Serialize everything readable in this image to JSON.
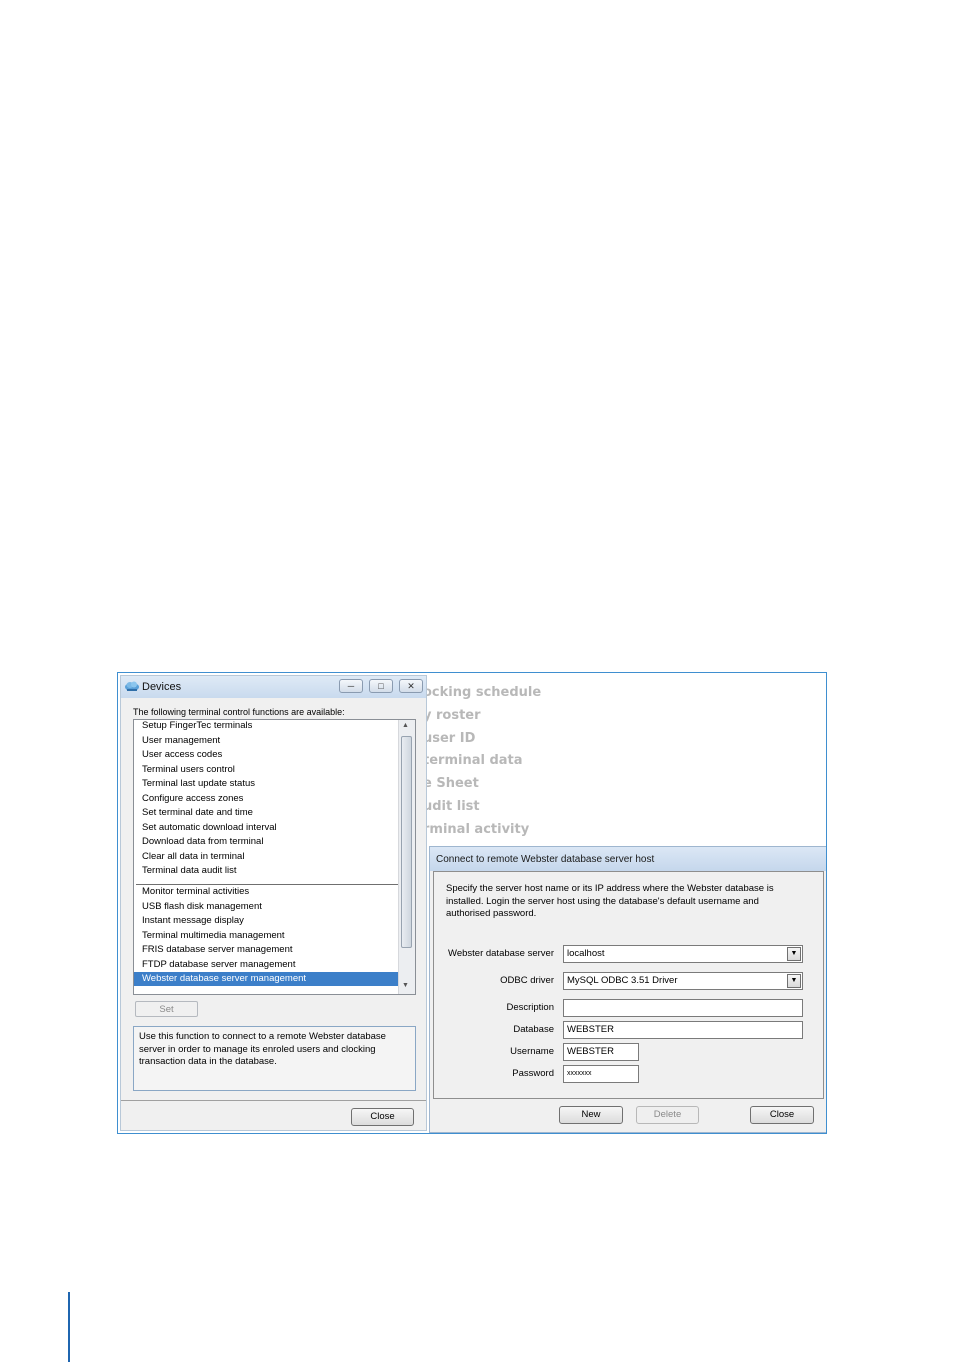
{
  "devices": {
    "title": "Devices",
    "intro": "The following terminal control functions are available:",
    "functions": [
      "Setup FingerTec terminals",
      "User management",
      "User access codes",
      "Terminal users control",
      "Terminal last update status",
      "Configure access zones",
      "Set terminal date and time",
      "Set automatic download interval",
      "Download data from terminal",
      "Clear all data in terminal",
      "Terminal data audit list",
      "Monitor terminal activities",
      "USB flash disk management",
      "Instant message display",
      "Terminal multimedia management",
      "FRIS database server management",
      "FTDP database server management",
      "Webster database server management"
    ],
    "selected_function": "Webster database server management",
    "set_label": "Set",
    "description": "Use this function to connect to a remote Webster database server in order to manage its enroled users and clocking transaction data in the database.",
    "close_label": "Close"
  },
  "background_menu": [
    "ocking schedule",
    "y roster",
    "user ID",
    "terminal data",
    "e Sheet",
    "udit list",
    "rminal activity"
  ],
  "connect": {
    "title": "Connect to remote Webster database server host",
    "instructions": "Specify the server host name or its IP address where the Webster database is installed. Login the server host using the database's default username and authorised password.",
    "server_label": "Webster database server",
    "server_value": "localhost",
    "driver_label": "ODBC driver",
    "driver_value": "MySQL ODBC 3.51 Driver",
    "description_label": "Description",
    "description_value": "",
    "database_label": "Database",
    "database_value": "WEBSTER",
    "username_label": "Username",
    "username_value": "WEBSTER",
    "password_label": "Password",
    "password_value": "xxxxxxx",
    "new_label": "New",
    "delete_label": "Delete",
    "close_label": "Close"
  }
}
